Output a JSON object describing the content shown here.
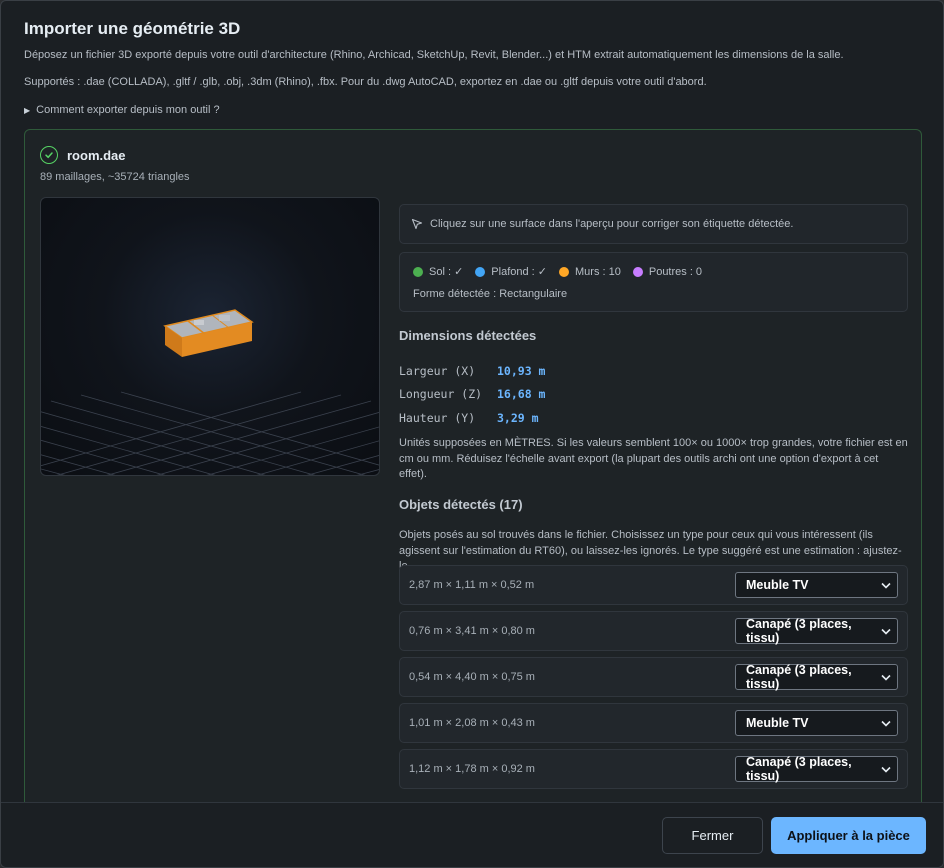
{
  "modal": {
    "title": "Importer une géométrie 3D",
    "intro_1": "Déposez un fichier 3D exporté depuis votre outil d'architecture (Rhino, Archicad, SketchUp, Revit, Blender...) et HTM extrait automatiquement les dimensions de la salle.",
    "intro_2": "Supportés : .dae (COLLADA), .gltf / .glb, .obj, .3dm (Rhino), .fbx. Pour du .dwg AutoCAD, exportez en .dae ou .gltf depuis votre outil d'abord.",
    "howto": "Comment exporter depuis mon outil ?"
  },
  "file": {
    "name": "room.dae",
    "meta": "89 maillages, ~35724 triangles"
  },
  "hint": "Cliquez sur une surface dans l'aperçu pour corriger son étiquette détectée.",
  "legend": [
    {
      "label": "Sol : ✓",
      "color": "#4caf50"
    },
    {
      "label": "Plafond : ✓",
      "color": "#42a5f5"
    },
    {
      "label": "Murs : 10",
      "color": "#ffa726"
    },
    {
      "label": "Poutres : 0",
      "color": "#c77dff"
    }
  ],
  "shape": "Forme détectée : Rectangulaire",
  "dimensions": {
    "title": "Dimensions détectées",
    "rows": [
      {
        "label": "Largeur (X)",
        "value": "10,93 m"
      },
      {
        "label": "Longueur (Z)",
        "value": "16,68 m"
      },
      {
        "label": "Hauteur (Y)",
        "value": "3,29 m"
      }
    ],
    "note": "Unités supposées en MÈTRES. Si les valeurs semblent 100× ou 1000× trop grandes, votre fichier est en cm ou mm. Réduisez l'échelle avant export (la plupart des outils archi ont une option d'export à cet effet)."
  },
  "objects": {
    "title": "Objets détectés (17)",
    "note": "Objets posés au sol trouvés dans le fichier. Choisissez un type pour ceux qui vous intéressent (ils agissent sur l'estimation du RT60), ou laissez-les ignorés. Le type suggéré est une estimation : ajustez-le.",
    "rows": [
      {
        "dims": "2,87 m × 1,11 m × 0,52 m",
        "type": "Meuble TV"
      },
      {
        "dims": "0,76 m × 3,41 m × 0,80 m",
        "type": "Canapé (3 places, tissu)"
      },
      {
        "dims": "0,54 m × 4,40 m × 0,75 m",
        "type": "Canapé (3 places, tissu)"
      },
      {
        "dims": "1,01 m × 2,08 m × 0,43 m",
        "type": "Meuble TV"
      },
      {
        "dims": "1,12 m × 1,78 m × 0,92 m",
        "type": "Canapé (3 places, tissu)"
      }
    ]
  },
  "footer": {
    "close": "Fermer",
    "apply": "Appliquer à la pièce"
  }
}
